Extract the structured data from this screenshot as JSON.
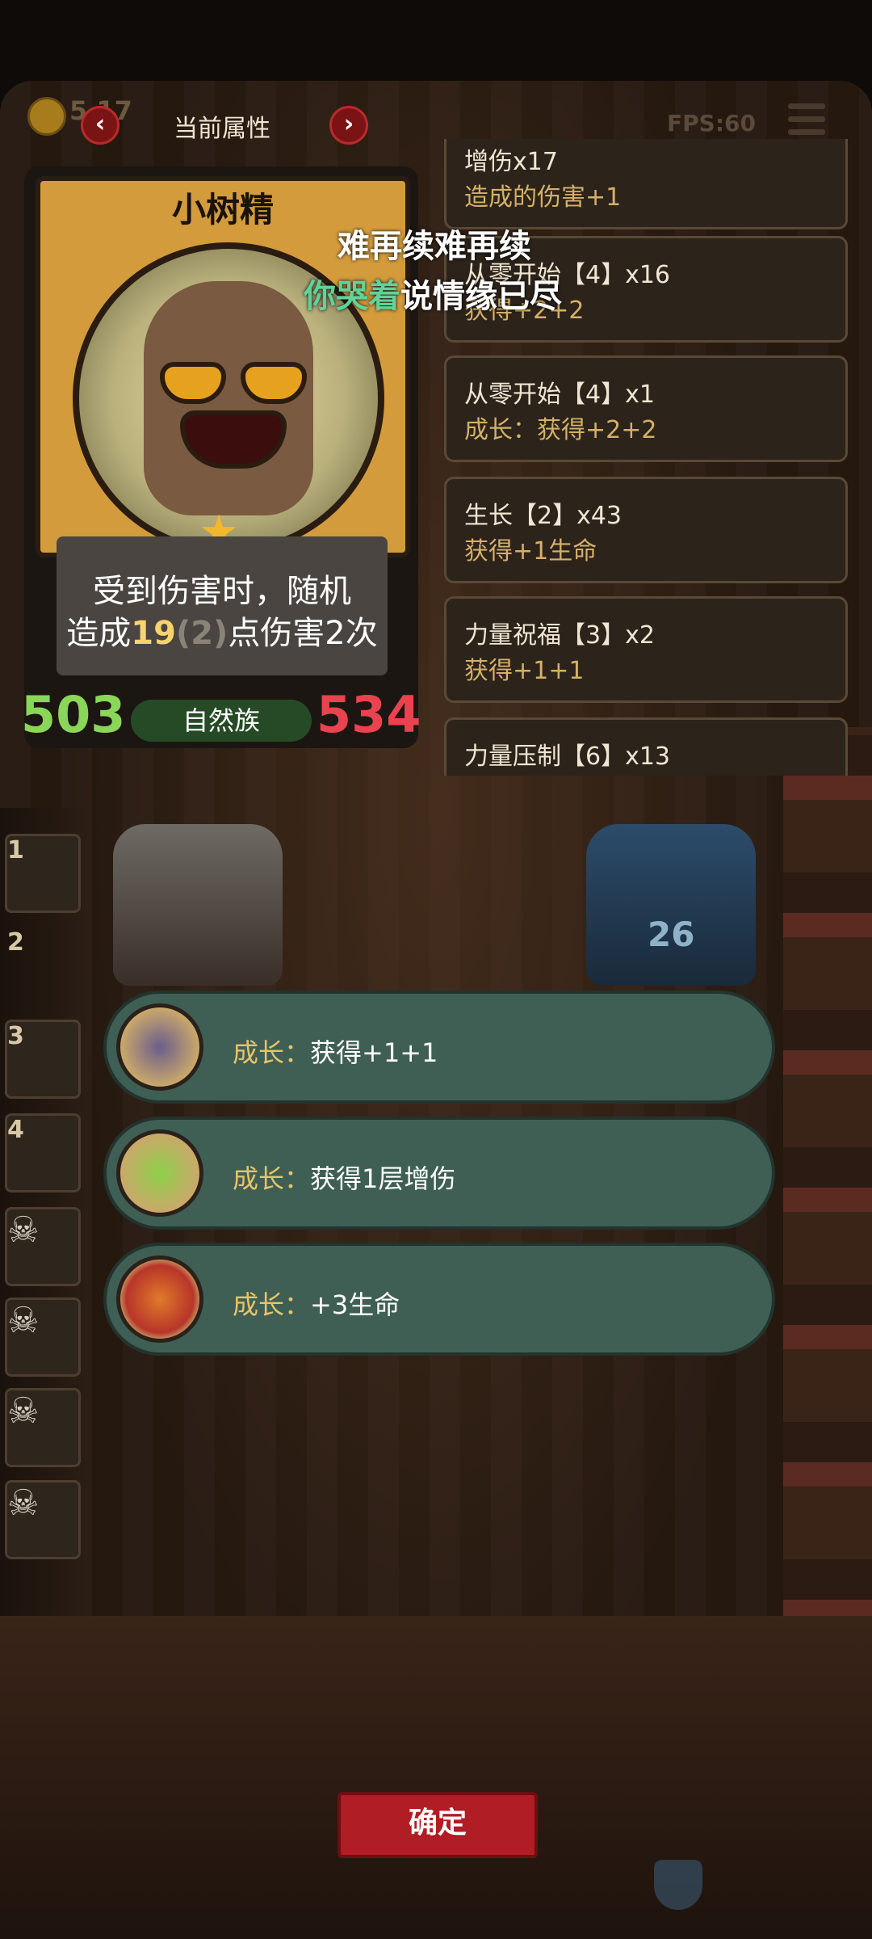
{
  "top_bar": {
    "coins": "5  17",
    "title": "当前属性",
    "fps": "FPS:60"
  },
  "card": {
    "name": "小树精",
    "desc_line1": "受到伤害时，随机",
    "desc_prefix": "造成",
    "desc_damage": "19",
    "desc_base": "(2)",
    "desc_suffix": "点伤害2次",
    "attack": "503",
    "tribe": "自然族",
    "health": "534"
  },
  "overlay_lyrics": {
    "line1": "难再续难再续",
    "line2_highlight": "你哭着",
    "line2_rest": "说情缘已尽"
  },
  "attributes": [
    {
      "title": "增伤x17",
      "sub": "造成的伤害+1"
    },
    {
      "title": "从零开始【4】x16",
      "sub": "获得+2+2"
    },
    {
      "title": "从零开始【4】x1",
      "sub": "成长：获得+2+2"
    },
    {
      "title": "生长【2】x43",
      "sub": "获得+1生命"
    },
    {
      "title": "力量祝福【3】x2",
      "sub": "获得+1+1"
    },
    {
      "title": "力量压制【6】x13",
      "sub": ""
    }
  ],
  "side_slots": [
    {
      "num": "1",
      "icon": "wizard-portrait"
    },
    {
      "num": "2",
      "icon": "empty"
    },
    {
      "num": "3",
      "icon": "ghost-portrait"
    },
    {
      "num": "4",
      "icon": "dark-portrait"
    },
    {
      "num": "",
      "icon": "skull-icon"
    },
    {
      "num": "",
      "icon": "skull-icon"
    },
    {
      "num": "",
      "icon": "skull-icon"
    },
    {
      "num": "",
      "icon": "skull-icon"
    }
  ],
  "opponent_level": "26",
  "options": [
    {
      "key": "成长",
      "sep": "：",
      "text": "获得+1+1",
      "icon": "spellbook-icon"
    },
    {
      "key": "成长",
      "sep": "：",
      "text": "获得1层增伤",
      "icon": "crystal-icon"
    },
    {
      "key": "成长",
      "sep": "：",
      "text": "+3生命",
      "icon": "shield-emblem-icon"
    }
  ],
  "confirm_label": "确定",
  "colors": {
    "attack": "#8ad659",
    "health": "#e8434f",
    "option_bg": "#3f5f55",
    "confirm": "#b01d24",
    "highlight_gold": "#e8c467"
  }
}
